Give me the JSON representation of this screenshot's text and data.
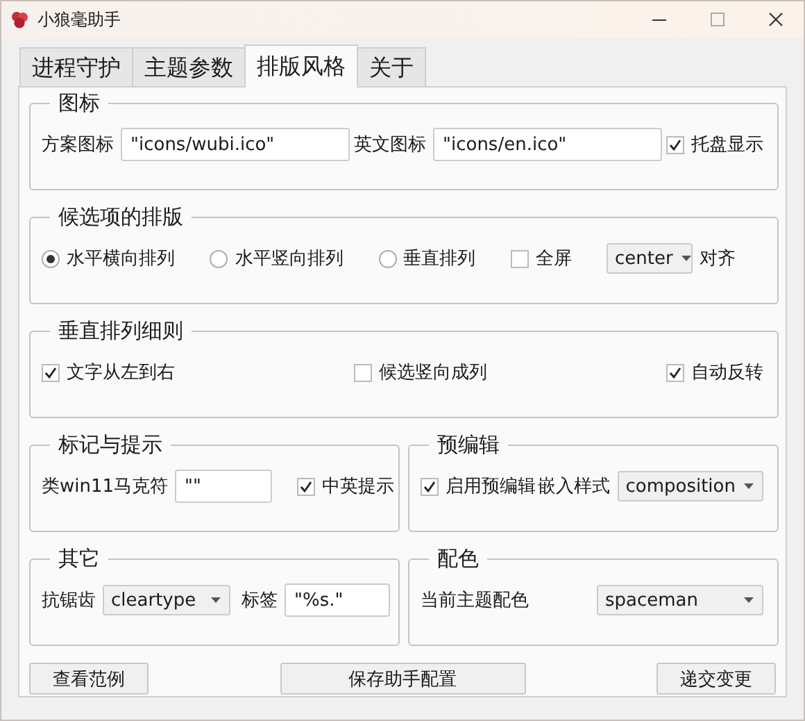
{
  "window": {
    "title": "小狼毫助手"
  },
  "tabs": [
    {
      "label": "进程守护",
      "selected": false
    },
    {
      "label": "主题参数",
      "selected": false
    },
    {
      "label": "排版风格",
      "selected": true
    },
    {
      "label": "关于",
      "selected": false
    }
  ],
  "rows": [
    {
      "sections": [
        {
          "title": "图标",
          "items": [
            {
              "kind": "text_field",
              "label": "方案图标",
              "value": "\"icons/wubi.ico\""
            },
            {
              "kind": "text_field",
              "label": "英文图标",
              "value": "\"icons/en.ico\""
            },
            {
              "kind": "checkbox",
              "label": "托盘显示",
              "checked": true
            }
          ]
        }
      ]
    },
    {
      "sections": [
        {
          "title": "候选项的排版",
          "items": [
            {
              "kind": "radio",
              "label": "水平横向排列",
              "selected": true
            },
            {
              "kind": "radio",
              "label": "水平竖向排列",
              "selected": false
            },
            {
              "kind": "radio",
              "label": "垂直排列",
              "selected": false
            },
            {
              "kind": "checkbox",
              "label": "全屏",
              "checked": false
            },
            {
              "kind": "dropdown",
              "value": "center",
              "suffix": "对齐"
            }
          ]
        }
      ]
    },
    {
      "sections": [
        {
          "title": "垂直排列细则",
          "items": [
            {
              "kind": "checkbox",
              "label": "文字从左到右",
              "checked": true
            },
            {
              "kind": "checkbox",
              "label": "候选竖向成列",
              "checked": false
            },
            {
              "kind": "checkbox",
              "label": "自动反转",
              "checked": true
            }
          ]
        }
      ]
    },
    {
      "sections": [
        {
          "title": "标记与提示",
          "items": [
            {
              "kind": "text_field",
              "label": "类win11马克符",
              "value": "\"\""
            },
            {
              "kind": "checkbox",
              "label": "中英提示",
              "checked": true
            }
          ]
        },
        {
          "title": "预编辑",
          "items": [
            {
              "kind": "checkbox",
              "label": "启用预编辑",
              "checked": true
            },
            {
              "kind": "dropdown",
              "label": "嵌入样式",
              "value": "composition"
            }
          ]
        }
      ]
    },
    {
      "sections": [
        {
          "title": "其它",
          "items": [
            {
              "kind": "dropdown",
              "label": "抗锯齿",
              "value": "cleartype"
            },
            {
              "kind": "text_field",
              "label": "标签",
              "value": "\"%s.\""
            }
          ]
        },
        {
          "title": "配色",
          "items": [
            {
              "kind": "dropdown",
              "label": "当前主题配色",
              "value": "spaceman"
            }
          ]
        }
      ]
    }
  ],
  "buttons": [
    {
      "label": "查看范例"
    },
    {
      "label": "保存助手配置"
    },
    {
      "label": "递交变更"
    }
  ]
}
